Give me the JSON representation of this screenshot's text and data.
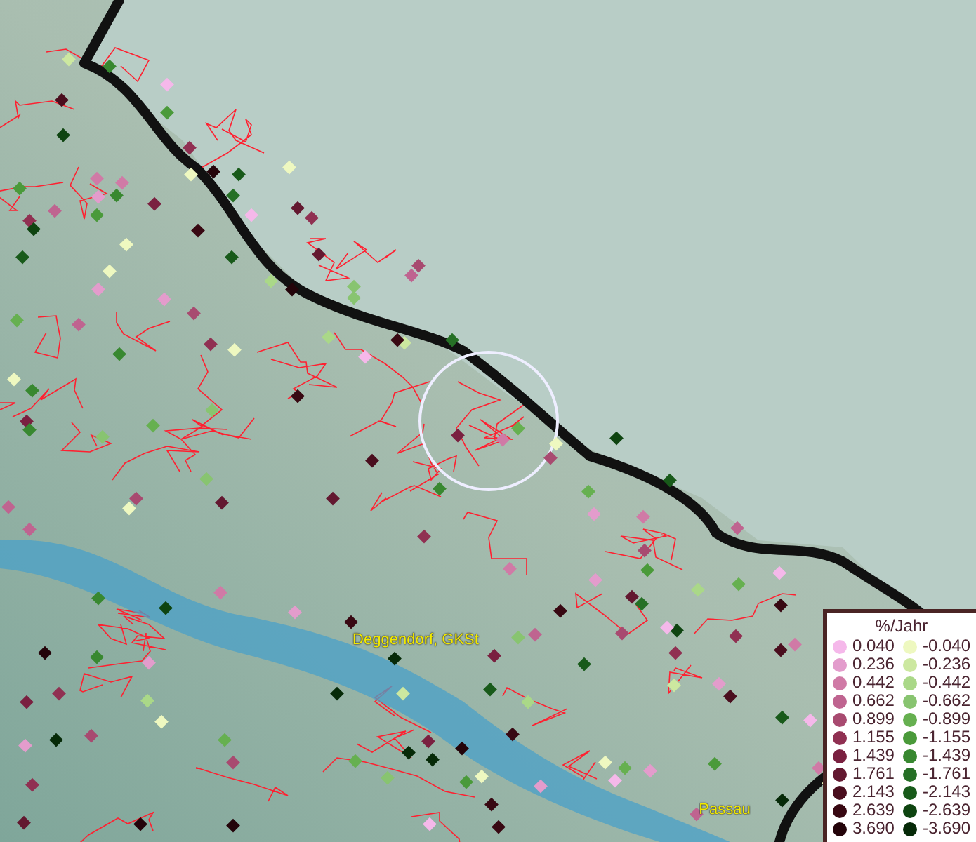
{
  "map": {
    "places": [
      {
        "name": "Deggendorf, GKSt"
      },
      {
        "name": "Passau"
      }
    ]
  },
  "legend": {
    "title": "%/Jahr",
    "positive": [
      {
        "label": "0.040",
        "color": "#f5b8ea"
      },
      {
        "label": "0.236",
        "color": "#e39ccc"
      },
      {
        "label": "0.442",
        "color": "#d07aa6"
      },
      {
        "label": "0.662",
        "color": "#bf6490"
      },
      {
        "label": "0.899",
        "color": "#a84a70"
      },
      {
        "label": "1.155",
        "color": "#903052"
      },
      {
        "label": "1.439",
        "color": "#7a2040"
      },
      {
        "label": "1.761",
        "color": "#631830"
      },
      {
        "label": "2.143",
        "color": "#4a0e1e"
      },
      {
        "label": "2.639",
        "color": "#380812"
      },
      {
        "label": "3.690",
        "color": "#24040a"
      }
    ],
    "negative": [
      {
        "label": "-0.040",
        "color": "#eef8c0"
      },
      {
        "label": "-0.236",
        "color": "#cce8a0"
      },
      {
        "label": "-0.442",
        "color": "#aad888"
      },
      {
        "label": "-0.662",
        "color": "#88c470"
      },
      {
        "label": "-0.899",
        "color": "#66b050"
      },
      {
        "label": "-1.155",
        "color": "#4a9a3a"
      },
      {
        "label": "-1.439",
        "color": "#388830"
      },
      {
        "label": "-1.761",
        "color": "#267026"
      },
      {
        "label": "-2.143",
        "color": "#185a1a"
      },
      {
        "label": "-2.639",
        "color": "#0e4410"
      },
      {
        "label": "-3.690",
        "color": "#062a08"
      }
    ]
  }
}
